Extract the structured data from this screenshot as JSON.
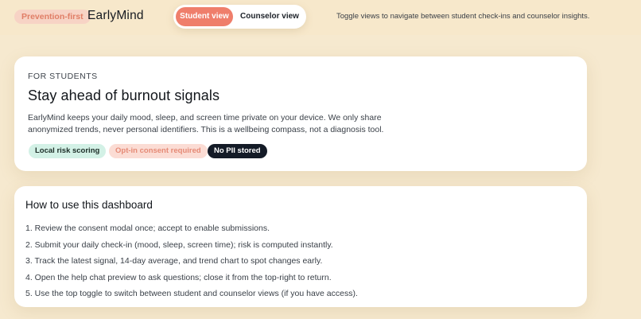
{
  "header": {
    "badge": "Prevention-first",
    "brand": "EarlyMind",
    "toggle": {
      "student_label": "Student view",
      "counselor_label": "Counselor view",
      "active": "Student view"
    },
    "hint": "Toggle views to navigate between student check-ins and counselor insights."
  },
  "colors": {
    "background": "#f6e9cf",
    "accent": "#ef7e6b",
    "badge_bg": "#f7d3c5",
    "tag_green": "#d3f1e6",
    "tag_pink": "#fbdcd4",
    "tag_dark": "#141b27"
  },
  "intro_card": {
    "eyebrow": "FOR STUDENTS",
    "title": "Stay ahead of burnout signals",
    "body": "EarlyMind keeps your daily mood, sleep, and screen time private on your device. We only share anonymized trends, never personal identifiers. This is a wellbeing compass, not a diagnosis tool.",
    "tags": [
      "Local risk scoring",
      "Opt-in consent required",
      "No PII stored"
    ]
  },
  "howto_card": {
    "title": "How to use this dashboard",
    "steps": [
      "1. Review the consent modal once; accept to enable submissions.",
      "2. Submit your daily check-in (mood, sleep, screen time); risk is computed instantly.",
      "3. Track the latest signal, 14-day average, and trend chart to spot changes early.",
      "4. Open the help chat preview to ask questions; close it from the top-right to return.",
      "5. Use the top toggle to switch between student and counselor views (if you have access)."
    ]
  }
}
